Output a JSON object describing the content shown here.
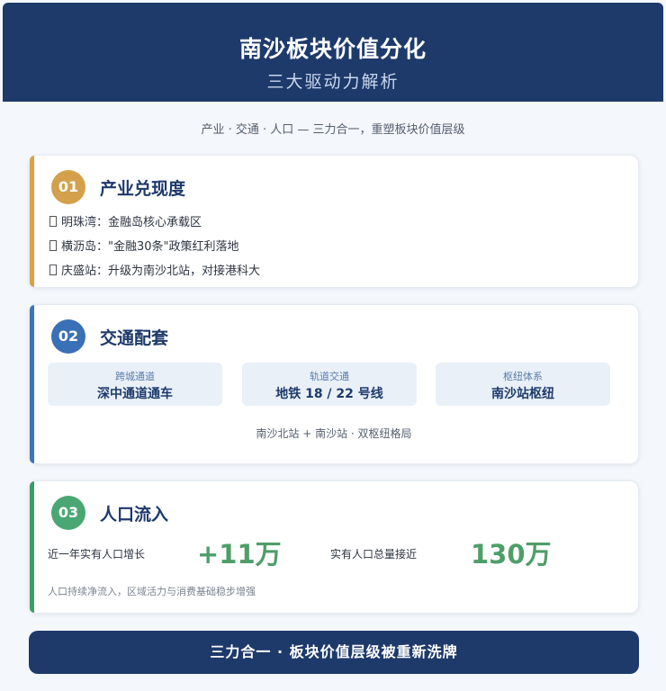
{
  "header": {
    "title": "南沙板块价值分化",
    "subtitle": "三大驱动力解析"
  },
  "tagline": "产业 · 交通 · 人口 — 三力合一，重塑板块价值层级",
  "cards": {
    "industry": {
      "number": "01",
      "title": "产业兑现度",
      "items": [
        "明珠湾：金融岛核心承载区",
        "横沥岛：\"金融30条\"政策红利落地",
        "庆盛站：升级为南沙北站，对接港科大"
      ]
    },
    "transport": {
      "number": "02",
      "title": "交通配套",
      "tiles": [
        {
          "label": "跨城通道",
          "value": "深中通道通车"
        },
        {
          "label": "轨道交通",
          "value": "地铁 18 / 22 号线"
        },
        {
          "label": "枢纽体系",
          "value": "南沙站枢纽"
        }
      ],
      "note": "南沙北站 + 南沙站 · 双枢纽格局"
    },
    "population": {
      "number": "03",
      "title": "人口流入",
      "stats": [
        {
          "label": "近一年实有人口增长",
          "value": "+11万"
        },
        {
          "label": "实有人口总量接近",
          "value": "130万"
        }
      ],
      "note": "人口持续净流入，区域活力与消费基础稳步增强"
    }
  },
  "footer": "三力合一 · 板块价值层级被重新洗牌",
  "colors": {
    "navy": "#1e3a6b",
    "gold": "#d4a04b",
    "blue": "#3a70b5",
    "green": "#4aa773"
  }
}
